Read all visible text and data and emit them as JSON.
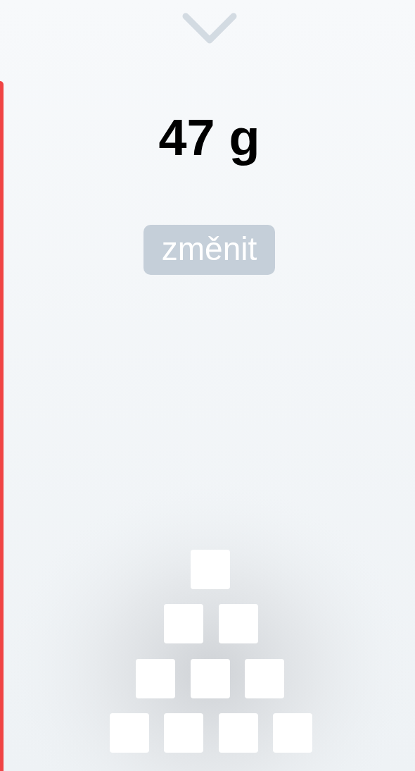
{
  "amount": "47 g",
  "change_button": {
    "label": "změnit"
  }
}
